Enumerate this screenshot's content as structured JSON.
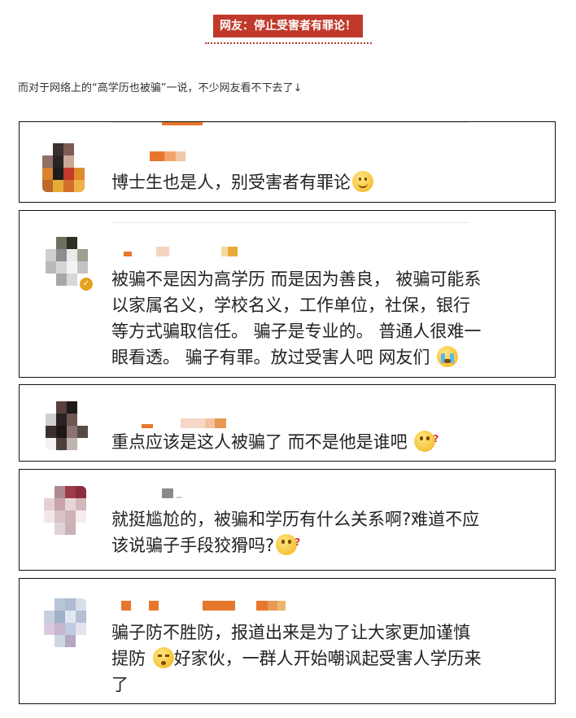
{
  "header": {
    "title": "网友：停止受害者有罪论！"
  },
  "intro": "而对于网络上的“高学历也被骗”一说，不少网友看不下去了↓",
  "colors": {
    "accent": "#c0392b",
    "blur_orange": "#e8772e"
  },
  "comments": [
    {
      "line1": "博士生也是人，别受害者有罪论",
      "emoji": "smile-emoji"
    },
    {
      "line1": "被骗不是因为高学历 而是因为善良， 被骗可能系",
      "line2": "以家属名义，学校名义，工作单位，社保，银行",
      "line3": "等方式骗取信任。 骗子是专业的。 普通人很难一",
      "line4": "眼看透。 骗子有罪。放过受害人吧 网友们",
      "emoji": "crying-emoji",
      "verified_icon": "verified-badge-icon"
    },
    {
      "line1": "重点应该是这人被骗了  而不是他是谁吧",
      "emoji": "thinking-emoji"
    },
    {
      "line1": "就挺尴尬的，被骗和学历有什么关系啊?难道不应",
      "line2": "该说骗子手段狡猾吗?",
      "emoji": "thinking-emoji"
    },
    {
      "line1": "骗子防不胜防，报道出来是为了让大家更加谨慎",
      "line2a": "提防",
      "line2b": "好家伙，一群人开始嘲讽起受害人学历来",
      "line3": "了",
      "emoji": "sad-emoji"
    }
  ]
}
